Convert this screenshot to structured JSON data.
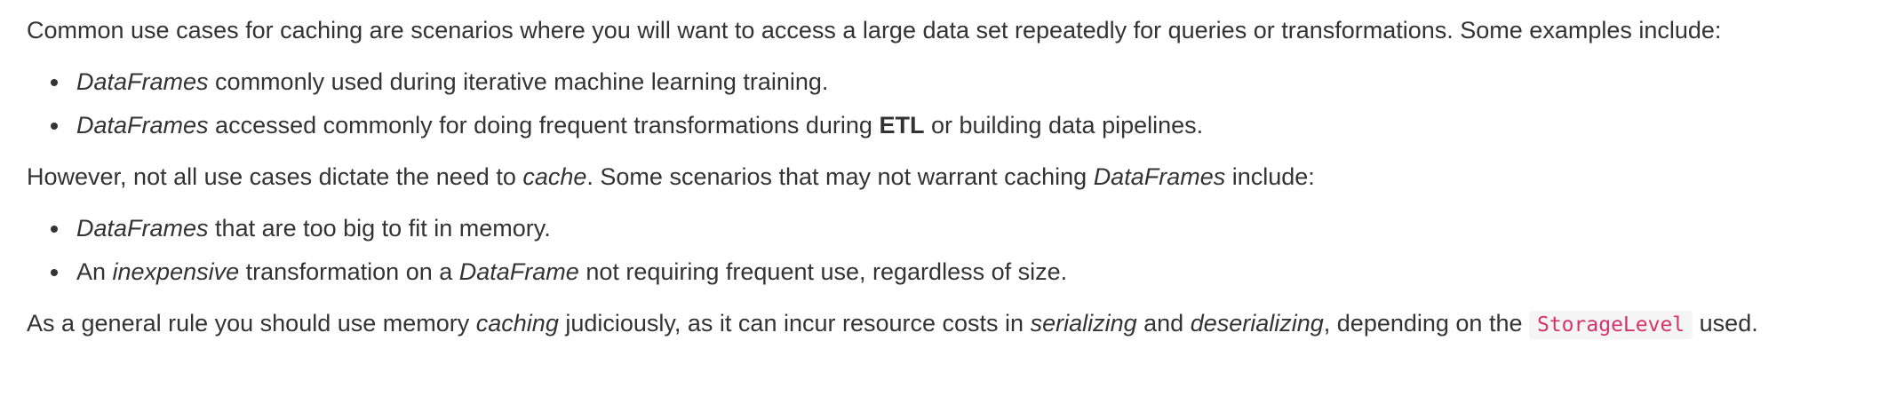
{
  "para1": {
    "text": "Common use cases for caching are scenarios where you will want to access a large data set repeatedly for queries or transformations. Some examples include:"
  },
  "list1": [
    {
      "term": "DataFrames",
      "text": " commonly used during iterative machine learning training."
    },
    {
      "term": "DataFrames",
      "text_before": " accessed commonly for doing frequent transformations during ",
      "bold": "ETL",
      "text_after": " or building data pipelines."
    }
  ],
  "para2": {
    "text1": "However, not all use cases dictate the need to ",
    "em1": "cache",
    "text2": ". Some scenarios that may not warrant caching ",
    "em2": "DataFrames",
    "text3": " include:"
  },
  "list2": [
    {
      "term": "DataFrames",
      "text": " that are too big to fit in memory."
    },
    {
      "text1": "An ",
      "em1": "inexpensive",
      "text2": " transformation on a ",
      "em2": "DataFrame",
      "text3": " not requiring frequent use, regardless of size."
    }
  ],
  "para3": {
    "text1": "As a general rule you should use memory ",
    "em1": "caching",
    "text2": " judiciously, as it can incur resource costs in ",
    "em2": "serializing",
    "text3": " and ",
    "em3": "deserializing",
    "text4": ", depending on the ",
    "code": "StorageLevel",
    "text5": " used."
  }
}
